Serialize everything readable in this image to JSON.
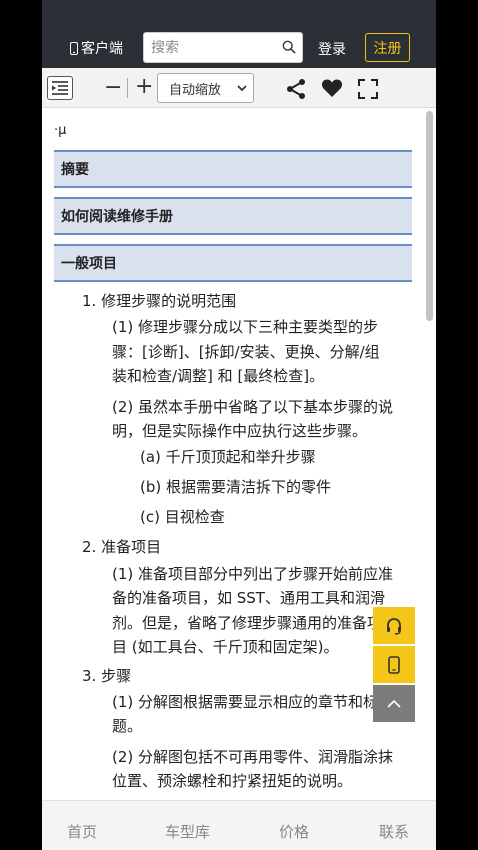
{
  "header": {
    "client_label": "客户端",
    "search_placeholder": "搜索",
    "login_label": "登录",
    "register_label": "注册"
  },
  "toolbar": {
    "zoom_value": "自动缩放",
    "minus": "−",
    "plus": "+"
  },
  "content": {
    "top_symbol": "·μ",
    "sections": [
      "摘要",
      "如何阅读维修手册",
      "一般项目"
    ],
    "lines": [
      "1. 修理步骤的说明范围",
      "(1) 修理步骤分成以下三种主要类型的步",
      "骤：[诊断]、[拆卸/安装、更换、分解/组",
      "装和检查/调整] 和 [最终检查]。",
      "(2) 虽然本手册中省略了以下基本步骤的说",
      "明，但是实际操作中应执行这些步骤。",
      "(a) 千斤顶顶起和举升步骤",
      "(b) 根据需要清洁拆下的零件",
      "(c) 目视检查",
      "2. 准备项目",
      "(1) 准备项目部分中列出了步骤开始前应准",
      "备的准备项目，如 SST、通用工具和润滑",
      "剂。但是，省略了修理步骤通用的准备项",
      "目 (如工具台、千斤顶和固定架)。",
      "3. 步骤",
      "(1) 分解图根据需要显示相应的章节和标",
      "题。",
      "(2) 分解图包括不可再用零件、润滑脂涂抹",
      "位置、预涂螺栓和拧紧扭矩的说明。"
    ]
  },
  "bottom_nav": [
    "首页",
    "车型库",
    "价格",
    "联系"
  ],
  "colors": {
    "header_bg": "#2b2f36",
    "accent": "#f4c21a",
    "section_bg": "#d9e1ee",
    "section_border": "#6b8fc4"
  }
}
